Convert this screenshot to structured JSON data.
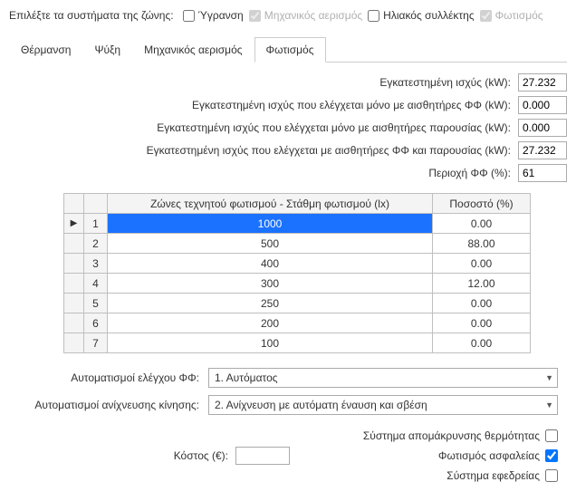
{
  "systems": {
    "title": "Επιλέξτε τα συστήματα της ζώνης:",
    "items": [
      {
        "label": "Ύγρανση",
        "checked": false,
        "disabled": false
      },
      {
        "label": "Μηχανικός αερισμός",
        "checked": true,
        "disabled": true
      },
      {
        "label": "Ηλιακός συλλέκτης",
        "checked": false,
        "disabled": false
      },
      {
        "label": "Φωτισμός",
        "checked": true,
        "disabled": true
      }
    ]
  },
  "tabs": [
    "Θέρμανση",
    "Ψύξη",
    "Μηχανικός αερισμός",
    "Φωτισμός"
  ],
  "active_tab": 3,
  "fields": [
    {
      "label": "Εγκατεστημένη ισχύς (kW):",
      "value": "27.232"
    },
    {
      "label": "Εγκατεστημένη ισχύς που ελέγχεται μόνο με αισθητήρες ΦΦ (kW):",
      "value": "0.000"
    },
    {
      "label": "Εγκατεστημένη ισχύς που ελέγχεται μόνο με αισθητήρες παρουσίας (kW):",
      "value": "0.000"
    },
    {
      "label": "Εγκατεστημένη ισχύς που ελέγχεται  με αισθητήρες ΦΦ και παρουσίας (kW):",
      "value": "27.232"
    },
    {
      "label": "Περιοχή ΦΦ (%):",
      "value": "61"
    }
  ],
  "grid": {
    "col1": "Ζώνες τεχνητού φωτισμού - Στάθμη φωτισμού (lx)",
    "col2": "Ποσοστό (%)",
    "rows": [
      {
        "n": "1",
        "lx": "1000",
        "pct": "0.00",
        "selected": true
      },
      {
        "n": "2",
        "lx": "500",
        "pct": "88.00"
      },
      {
        "n": "3",
        "lx": "400",
        "pct": "0.00"
      },
      {
        "n": "4",
        "lx": "300",
        "pct": "12.00"
      },
      {
        "n": "5",
        "lx": "250",
        "pct": "0.00"
      },
      {
        "n": "6",
        "lx": "200",
        "pct": "0.00"
      },
      {
        "n": "7",
        "lx": "100",
        "pct": "0.00"
      }
    ]
  },
  "combos": [
    {
      "label": "Αυτοματισμοί ελέγχου ΦΦ:",
      "value": "1. Αυτόματος"
    },
    {
      "label": "Αυτοματισμοί ανίχνευσης κίνησης:",
      "value": "2. Ανίχνευση με αυτόματη έναυση και σβέση"
    }
  ],
  "cost": {
    "label": "Κόστος (€):",
    "value": ""
  },
  "right_checks": [
    {
      "label": "Σύστημα απομάκρυνσης θερμότητας",
      "checked": false
    },
    {
      "label": "Φωτισμός ασφαλείας",
      "checked": true
    },
    {
      "label": "Σύστημα εφεδρείας",
      "checked": false
    }
  ]
}
